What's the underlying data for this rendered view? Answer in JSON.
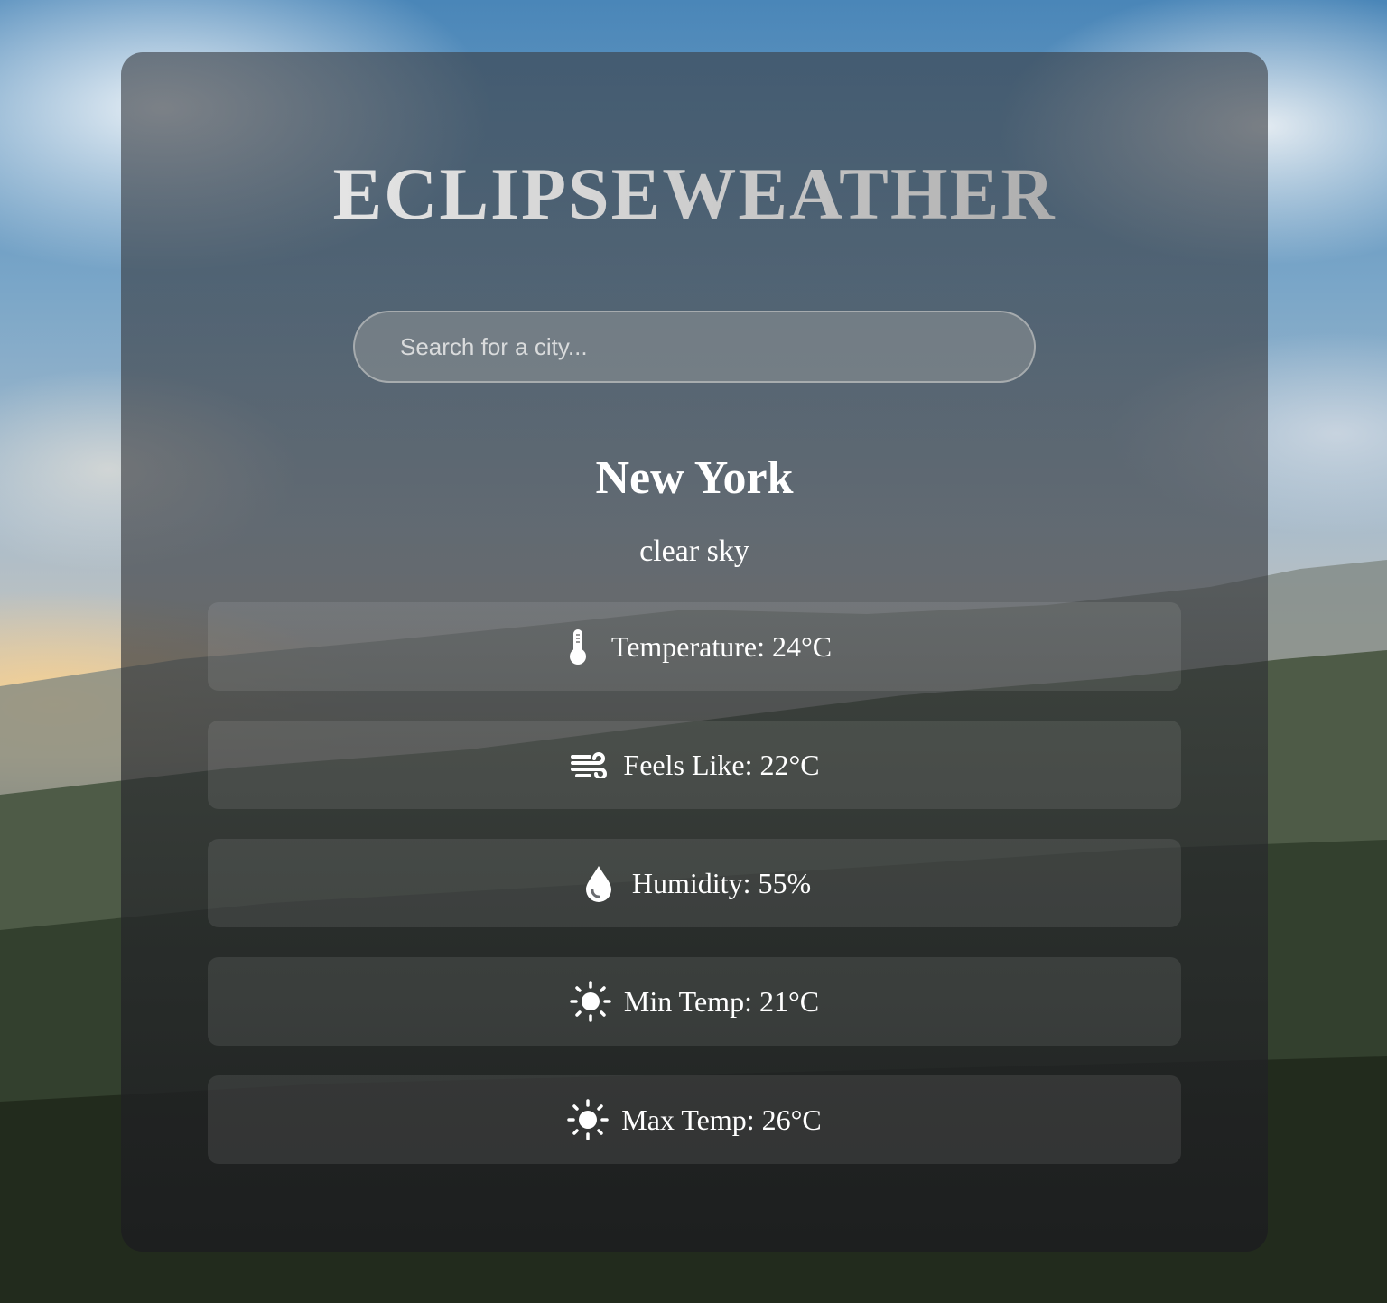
{
  "app": {
    "title": "ECLIPSEWEATHER"
  },
  "search": {
    "placeholder": "Search for a city..."
  },
  "weather": {
    "city": "New York",
    "description": "clear sky",
    "stats": [
      {
        "icon": "thermometer-icon",
        "label": "Temperature: 24°C"
      },
      {
        "icon": "wind-icon",
        "label": "Feels Like: 22°C"
      },
      {
        "icon": "droplet-icon",
        "label": "Humidity: 55%"
      },
      {
        "icon": "sun-icon",
        "label": "Min Temp: 21°C"
      },
      {
        "icon": "sun-icon",
        "label": "Max Temp: 26°C"
      }
    ]
  },
  "colors": {
    "card_bg": "#3a3e44",
    "text": "#ffffff",
    "title_gradient_start": "#f1f1f1",
    "title_gradient_end": "#9b9b9b"
  }
}
